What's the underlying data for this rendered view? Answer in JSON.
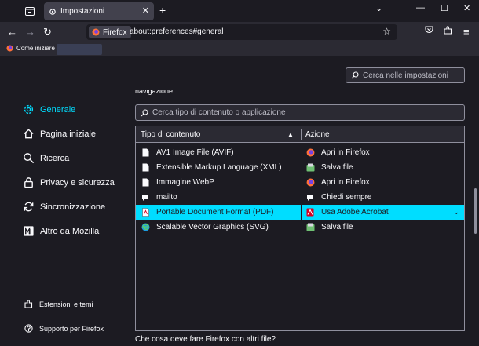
{
  "tabbar": {
    "tab_title": "Impostazioni"
  },
  "navbar": {
    "identity_label": "Firefox",
    "url": "about:preferences#general"
  },
  "bookmarks": {
    "item_label": "Come iniziare"
  },
  "prefs": {
    "search_placeholder": "Cerca nelle impostazioni",
    "section_heading": "navigazione",
    "filter_placeholder": "Cerca tipo di contenuto o applicazione",
    "question": "Che cosa deve fare Firefox con altri file?"
  },
  "sidebar": {
    "items": [
      {
        "label": "Generale",
        "icon": "gear-icon"
      },
      {
        "label": "Pagina iniziale",
        "icon": "home-icon"
      },
      {
        "label": "Ricerca",
        "icon": "search-icon"
      },
      {
        "label": "Privacy e sicurezza",
        "icon": "lock-icon"
      },
      {
        "label": "Sincronizzazione",
        "icon": "sync-icon"
      },
      {
        "label": "Altro da Mozilla",
        "icon": "mozilla-icon"
      }
    ],
    "bottom": [
      {
        "label": "Estensioni e temi",
        "icon": "puzzle-icon"
      },
      {
        "label": "Supporto per Firefox",
        "icon": "help-icon"
      }
    ]
  },
  "table": {
    "col_type": "Tipo di contenuto",
    "col_action": "Azione",
    "rows": [
      {
        "type": "AV1 Image File (AVIF)",
        "action": "Apri in Firefox",
        "type_icon": "file-icon",
        "action_icon": "firefox-icon"
      },
      {
        "type": "Extensible Markup Language (XML)",
        "action": "Salva file",
        "type_icon": "file-icon",
        "action_icon": "save-icon"
      },
      {
        "type": "Immagine WebP",
        "action": "Apri in Firefox",
        "type_icon": "file-icon",
        "action_icon": "firefox-icon"
      },
      {
        "type": "mailto",
        "action": "Chiedi sempre",
        "type_icon": "chat-icon",
        "action_icon": "chat-icon"
      },
      {
        "type": "Portable Document Format (PDF)",
        "action": "Usa Adobe Acrobat",
        "type_icon": "pdf-file-icon",
        "action_icon": "acrobat-icon"
      },
      {
        "type": "Scalable Vector Graphics (SVG)",
        "action": "Salva file",
        "type_icon": "edge-icon",
        "action_icon": "save-icon"
      }
    ]
  },
  "colors": {
    "accent": "#00ddff",
    "background": "#1c1b22",
    "toolbar": "#2b2a33"
  }
}
